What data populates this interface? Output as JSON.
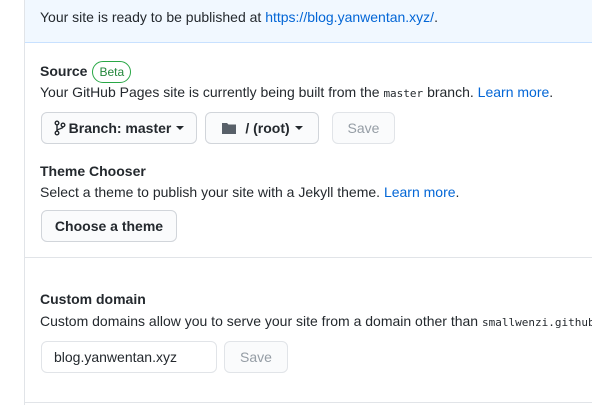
{
  "flash": {
    "text": "Your site is ready to be published at ",
    "url": "https://blog.yanwentan.xyz/",
    "suffix": "."
  },
  "source": {
    "title": "Source",
    "badge": "Beta",
    "desc_before": "Your GitHub Pages site is currently being built from the ",
    "branch_code": "master",
    "desc_after": " branch. ",
    "learn_more": "Learn more",
    "period": ".",
    "branch_button": "Branch: master",
    "folder_button": "/ (root)",
    "save": "Save"
  },
  "theme": {
    "title": "Theme Chooser",
    "desc": "Select a theme to publish your site with a Jekyll theme. ",
    "learn_more": "Learn more",
    "period": ".",
    "button": "Choose a theme"
  },
  "custom_domain": {
    "title": "Custom domain",
    "desc": "Custom domains allow you to serve your site from a domain other than ",
    "domain_code": "smallwenzi.github.io",
    "input_value": "blog.yanwentan.xyz",
    "save": "Save"
  }
}
